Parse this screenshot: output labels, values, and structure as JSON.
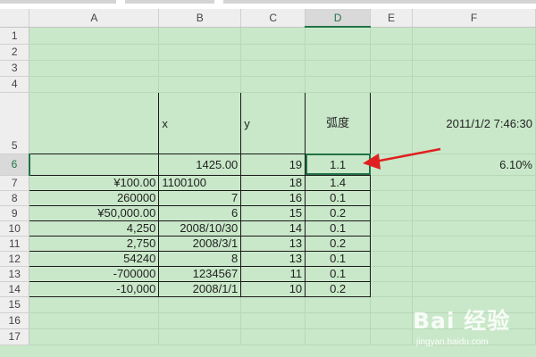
{
  "columns": [
    "A",
    "B",
    "C",
    "D",
    "E",
    "F"
  ],
  "selected_column": "D",
  "selected_row": "6",
  "rows": [
    {
      "n": "1"
    },
    {
      "n": "2"
    },
    {
      "n": "3"
    },
    {
      "n": "4"
    },
    {
      "n": "5",
      "a": "",
      "b": "x",
      "c": "y",
      "d": "弧度",
      "f": "2011/1/2 7:46:30"
    },
    {
      "n": "6",
      "a": "",
      "b": "1425.00",
      "c": "19",
      "d": "1.1",
      "f": "6.10%"
    },
    {
      "n": "7",
      "a": "¥100.00",
      "b": "1100100",
      "c": "18",
      "d": "1.4"
    },
    {
      "n": "8",
      "a": "260000",
      "b": "7",
      "c": "16",
      "d": "0.1"
    },
    {
      "n": "9",
      "a": "¥50,000.00",
      "b": "6",
      "c": "15",
      "d": "0.2"
    },
    {
      "n": "10",
      "a": "4,250",
      "b": "2008/10/30",
      "c": "14",
      "d": "0.1"
    },
    {
      "n": "11",
      "a": "2,750",
      "b": "2008/3/1",
      "c": "13",
      "d": "0.2"
    },
    {
      "n": "12",
      "a": "54240",
      "b": "8",
      "c": "13",
      "d": "0.1"
    },
    {
      "n": "13",
      "a": "-700000",
      "b": "1234567",
      "c": "11",
      "d": "0.1"
    },
    {
      "n": "14",
      "a": "-10,000",
      "b": "2008/1/1",
      "c": "10",
      "d": "0.2"
    },
    {
      "n": "15"
    },
    {
      "n": "16"
    },
    {
      "n": "17"
    }
  ],
  "watermark": {
    "main": "Bai 经验",
    "sub": "jingyan.baidu.com"
  },
  "colors": {
    "grid_fill": "#c9e8c9",
    "selection": "#217346",
    "arrow": "#e02020"
  }
}
